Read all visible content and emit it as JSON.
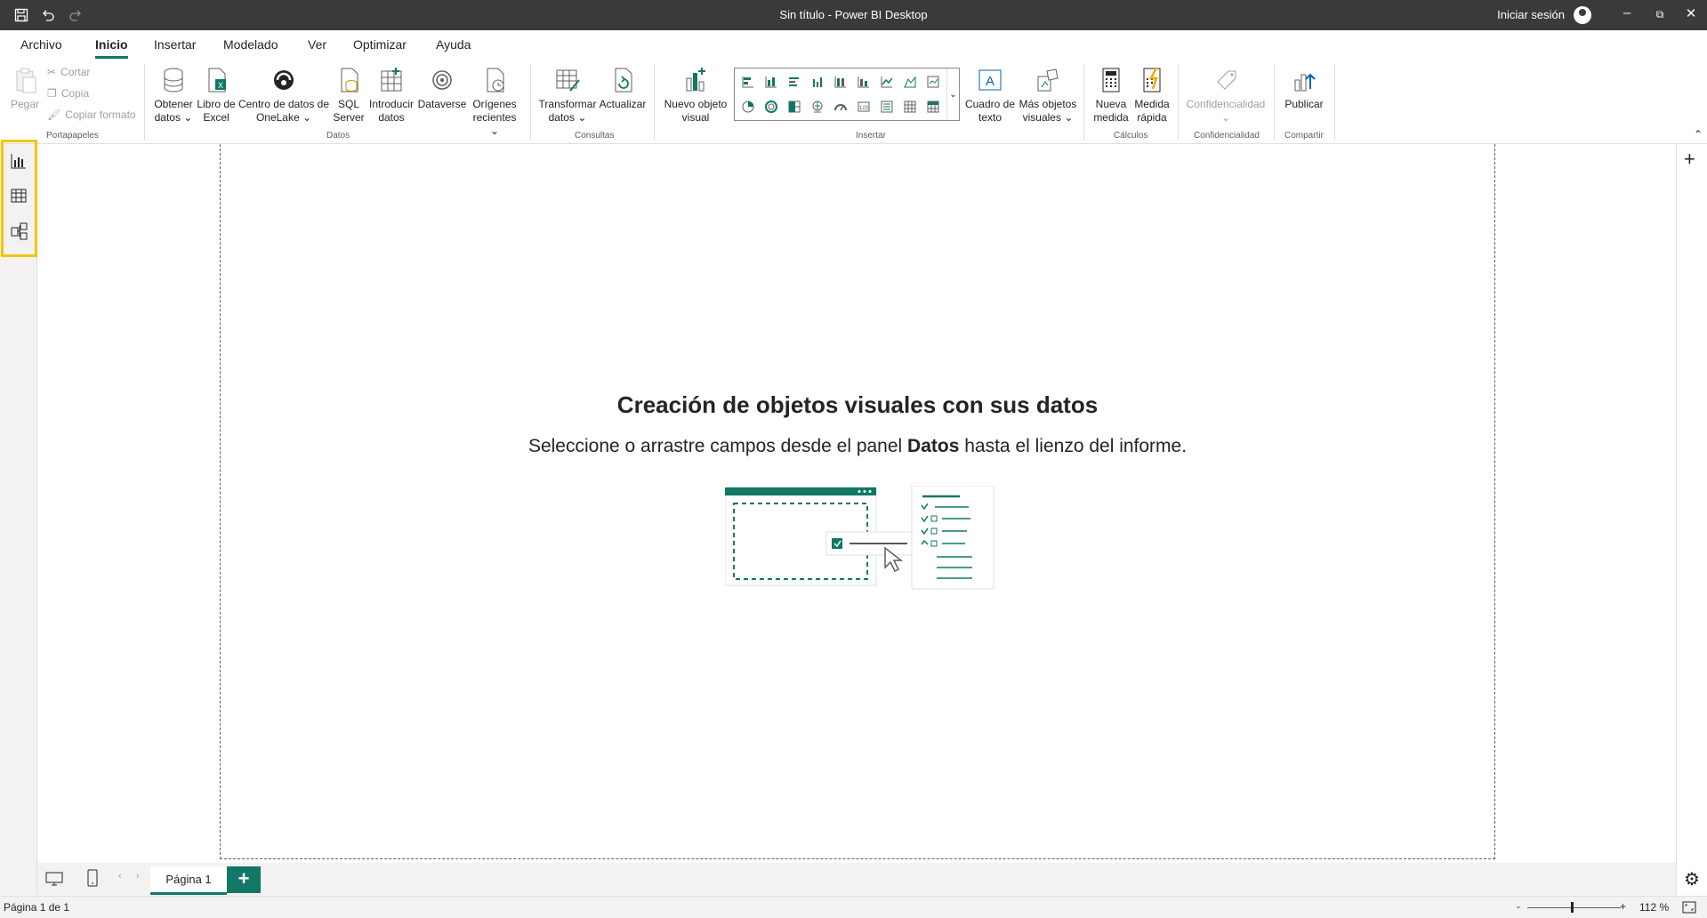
{
  "window": {
    "title": "Sin título - Power BI Desktop",
    "signin": "Iniciar sesión"
  },
  "menu": {
    "tabs": [
      "Archivo",
      "Inicio",
      "Insertar",
      "Modelado",
      "Ver",
      "Optimizar",
      "Ayuda"
    ],
    "active": "Inicio"
  },
  "ribbon": {
    "clipboard": {
      "paste": "Pegar",
      "cut": "Cortar",
      "copy": "Copia",
      "format_painter": "Copiar formato",
      "group": "Portapapeles"
    },
    "data": {
      "get_data_1": "Obtener",
      "get_data_2": "datos",
      "excel_1": "Libro de",
      "excel_2": "Excel",
      "onelake_1": "Centro de datos de",
      "onelake_2": "OneLake",
      "sql_1": "SQL",
      "sql_2": "Server",
      "enter_1": "Introducir",
      "enter_2": "datos",
      "dataverse": "Dataverse",
      "recent_1": "Orígenes",
      "recent_2": "recientes",
      "group": "Datos"
    },
    "queries": {
      "transform_1": "Transformar",
      "transform_2": "datos",
      "refresh": "Actualizar",
      "group": "Consultas"
    },
    "insert": {
      "new_visual_1": "Nuevo objeto",
      "new_visual_2": "visual",
      "textbox_1": "Cuadro de",
      "textbox_2": "texto",
      "more_visuals_1": "Más objetos",
      "more_visuals_2": "visuales",
      "group": "Insertar"
    },
    "calculations": {
      "new_measure_1": "Nueva",
      "new_measure_2": "medida",
      "quick_measure_1": "Medida",
      "quick_measure_2": "rápida",
      "group": "Cálculos"
    },
    "sensitivity": {
      "label": "Confidencialidad",
      "group": "Confidencialidad"
    },
    "share": {
      "publish": "Publicar",
      "group": "Compartir"
    }
  },
  "canvas": {
    "empty_title": "Creación de objetos visuales con sus datos",
    "empty_sub_before": "Seleccione o arrastre campos desde el panel ",
    "empty_sub_bold": "Datos",
    "empty_sub_after": " hasta el lienzo del informe."
  },
  "pages": {
    "tabs": [
      "Página 1"
    ],
    "add": "+"
  },
  "status": {
    "page_indicator": "Página 1 de 1",
    "zoom": "112 %",
    "zoom_minus": "-",
    "zoom_plus": "+"
  },
  "colors": {
    "accent": "#117865",
    "highlight": "#f5c400",
    "titlebar": "#3b3a39"
  }
}
